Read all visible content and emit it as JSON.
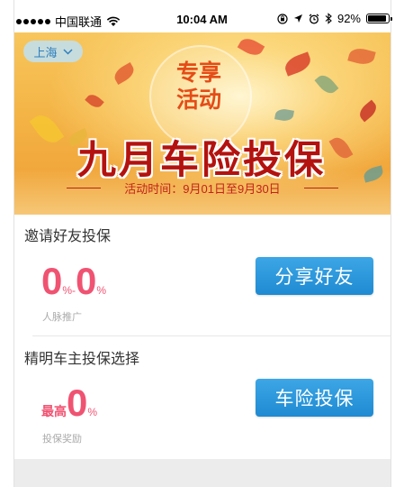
{
  "status_bar": {
    "carrier": "中国联通",
    "time": "10:04 AM",
    "battery": "92%",
    "battery_level": 0.92,
    "icons": [
      "signal-dots-icon",
      "wifi-icon",
      "screen-lock-icon",
      "location-icon",
      "alarm-icon",
      "bluetooth-icon",
      "battery-icon"
    ]
  },
  "banner": {
    "city": "上海",
    "tag_line1": "专享",
    "tag_line2": "活动",
    "title": "九月车险投保",
    "period": "活动时间：9月01日至9月30日"
  },
  "invite": {
    "title": "邀请好友投保",
    "rate_from": "0",
    "rate_sep": "%-",
    "rate_to": "0",
    "rate_unit": "%",
    "caption": "人脉推广",
    "button": "分享好友"
  },
  "owner": {
    "title": "精明车主投保选择",
    "rate_prefix": "最高",
    "rate": "0",
    "rate_unit": "%",
    "caption": "投保奖励",
    "button": "车险投保"
  },
  "colors": {
    "accent_blue": "#2b97dc",
    "rate_pink": "#f05372",
    "title_red": "#b3120f",
    "promo_orange": "#e44c17"
  }
}
